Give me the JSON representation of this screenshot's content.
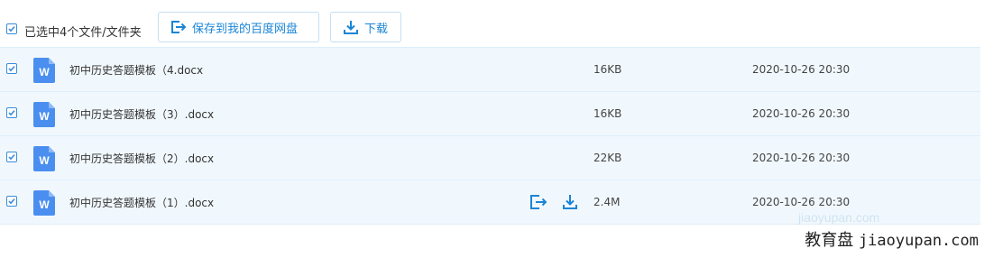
{
  "toolbar": {
    "selection_label": "已选中4个文件/文件夹",
    "save_to_baidu_label": "保存到我的百度网盘",
    "download_label": "下载",
    "save_icon": "save-to-disk-icon",
    "download_icon": "download-icon"
  },
  "files": [
    {
      "name": "初中历史答题模板（4.docx",
      "size": "16KB",
      "date": "2020-10-26 20:30",
      "checked": true,
      "icon": "word-doc-icon"
    },
    {
      "name": "初中历史答题模板（3）.docx",
      "size": "16KB",
      "date": "2020-10-26 20:30",
      "checked": true,
      "icon": "word-doc-icon"
    },
    {
      "name": "初中历史答题模板（2）.docx",
      "size": "22KB",
      "date": "2020-10-26 20:30",
      "checked": true,
      "icon": "word-doc-icon"
    },
    {
      "name": "初中历史答题模板（1）.docx",
      "size": "2.4M",
      "date": "2020-10-26 20:30",
      "checked": true,
      "icon": "word-doc-icon"
    }
  ],
  "word_icon_letter": "W",
  "watermark": {
    "text_cn": "教育盘",
    "text_url": "jiaoyupan.com",
    "faint_text": "jiaoyupan.com"
  },
  "colors": {
    "accent": "#1a85d6",
    "row_bg": "#f1f8fd",
    "word_icon": "#4a8ff0"
  }
}
